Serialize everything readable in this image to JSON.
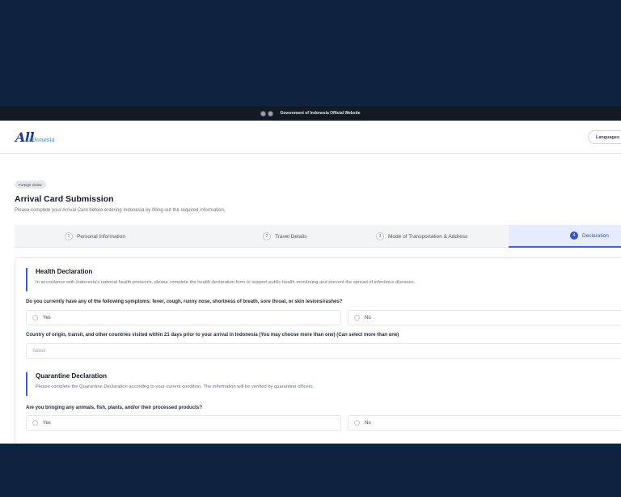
{
  "gov_bar": {
    "text": "Government of Indonesia Official Website"
  },
  "header": {
    "logo_main": "All",
    "logo_sub": "Indonesia",
    "languages_button": "Languages"
  },
  "visitor_badge": "Foreign Visitor",
  "page": {
    "title": "Arrival Card Submission",
    "subtitle": "Please complete your Arrival Card before entering Indonesia by filling out the required information."
  },
  "steps": [
    {
      "num": "1",
      "label": "Personal Information",
      "active": false
    },
    {
      "num": "2",
      "label": "Travel Details",
      "active": false
    },
    {
      "num": "3",
      "label": "Mode of Transportation & Address",
      "active": false
    },
    {
      "num": "4",
      "label": "Declaration",
      "active": true
    }
  ],
  "health": {
    "title": "Health Declaration",
    "description": "In accordance with Indonesia's national health protocols, please complete the health declaration form to support public health monitoring and prevent the spread of infectious diseases.",
    "symptoms_question": "Do you currently have any of the following symptoms: fever, cough, runny nose, shortness of breath, sore throat, or skin lesions/rashes?",
    "options": {
      "yes": "Yes",
      "no": "No"
    },
    "countries_question": "Country of origin, transit, and other countries visited within 21 days prior to your arrival in Indonesia (You may choose more than one) (Can select more than one)",
    "countries_placeholder": "Select"
  },
  "quarantine": {
    "title": "Quarantine Declaration",
    "description": "Please complete the Quarantine Declaration according to your current condition. The information will be verified by quarantine officers.",
    "question": "Are you bringing any animals, fish, plants, and/or their processed products?",
    "options": {
      "yes": "Yes",
      "no": "No"
    }
  },
  "colors": {
    "background": "#0d2340",
    "accent": "#2f55d4",
    "active_step_bg": "#e6ecfb"
  }
}
